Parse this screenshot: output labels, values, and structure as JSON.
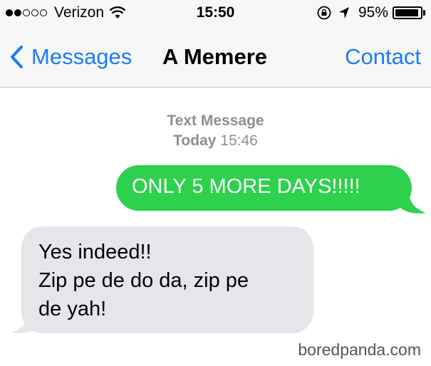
{
  "status_bar": {
    "signal_dots_filled": 2,
    "signal_dots_total": 5,
    "carrier": "Verizon",
    "time": "15:50",
    "battery_percent": "95%",
    "battery_level": 0.95
  },
  "nav": {
    "back_label": "Messages",
    "title": "A Memere",
    "contact_label": "Contact"
  },
  "conversation": {
    "header_type": "Text Message",
    "header_day": "Today",
    "header_time": "15:46"
  },
  "messages": [
    {
      "direction": "outgoing",
      "text": "ONLY 5 MORE DAYS!!!!!"
    },
    {
      "direction": "incoming",
      "lines": [
        "Yes indeed!!",
        "Zip pe de do da, zip pe",
        "de yah!"
      ]
    }
  ],
  "watermark": "boredpanda.com",
  "colors": {
    "ios_blue": "#1a7cf4",
    "outgoing_bubble": "#2dd14c",
    "incoming_bubble": "#e5e5ea",
    "meta_gray": "#8e8e93"
  }
}
